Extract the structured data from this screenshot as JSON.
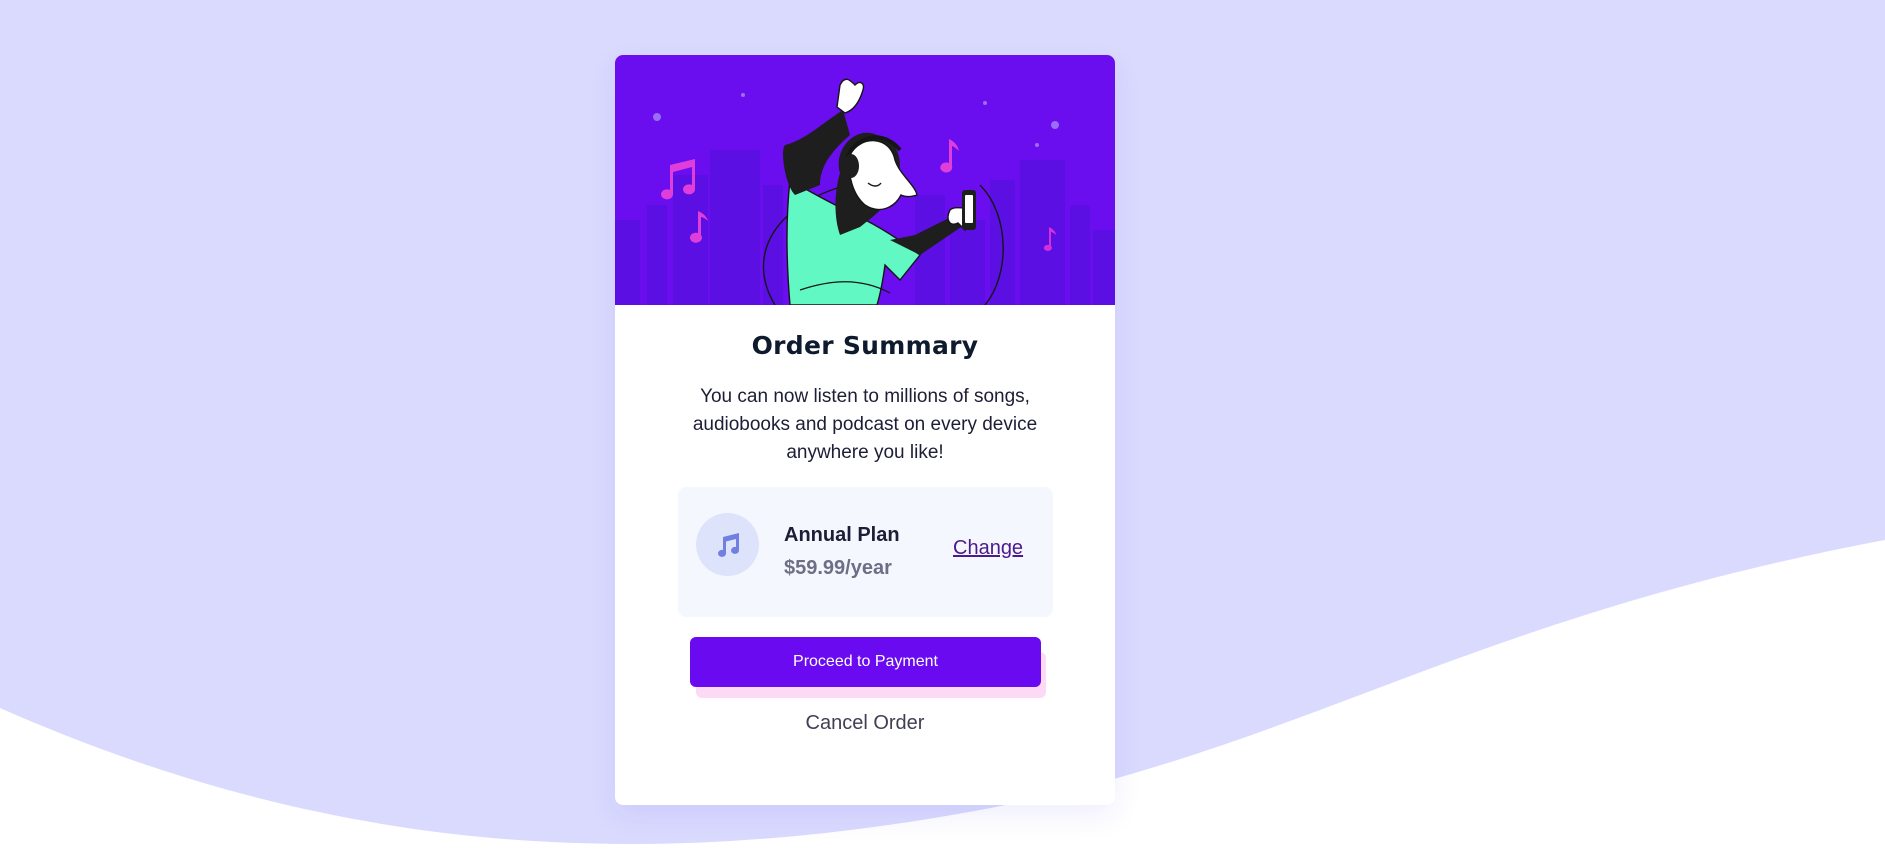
{
  "colors": {
    "page_bg": "#dadafe",
    "wave_bg": "#ffffff",
    "accent": "#6a0af0",
    "hero_bg": "#6a0ef0",
    "link": "#4b1a8c",
    "plan_bg": "#f5f7ff"
  },
  "card": {
    "title": "Order Summary",
    "description": "You can now listen to millions of songs, audiobooks and podcast on every device anywhere you like!"
  },
  "hero": {
    "illustration": "dancing-person-with-headphones"
  },
  "plan": {
    "icon": "music-note-icon",
    "name": "Annual Plan",
    "price": "$59.99/year",
    "change_label": "Change"
  },
  "actions": {
    "proceed_label": "Proceed to Payment",
    "cancel_label": "Cancel Order"
  }
}
